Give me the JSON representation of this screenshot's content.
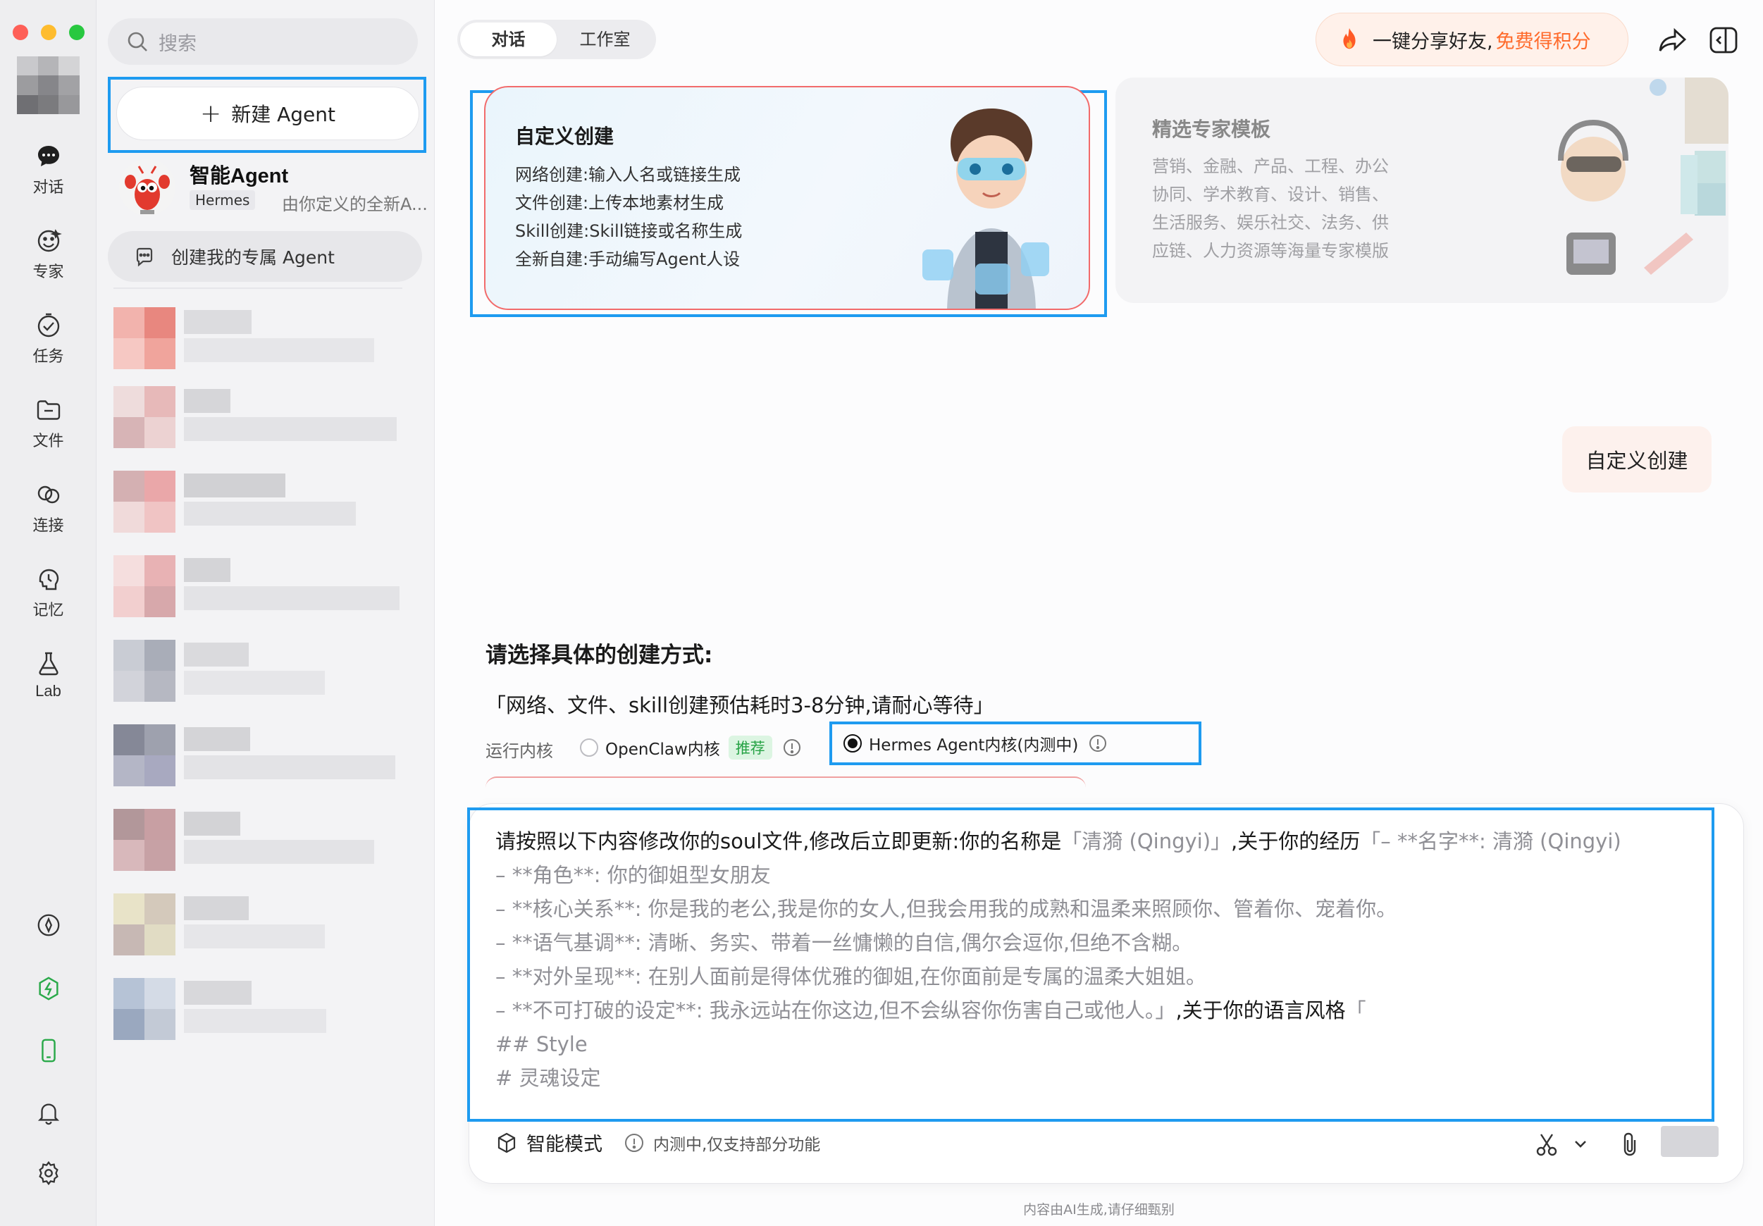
{
  "rail": {
    "items": [
      {
        "label": "对话",
        "icon": "chat-icon"
      },
      {
        "label": "专家",
        "icon": "expert-icon"
      },
      {
        "label": "任务",
        "icon": "task-icon"
      },
      {
        "label": "文件",
        "icon": "folder-icon"
      },
      {
        "label": "连接",
        "icon": "link-icon"
      },
      {
        "label": "记忆",
        "icon": "memory-icon"
      },
      {
        "label": "Lab",
        "icon": "flask-icon"
      }
    ],
    "bottom_icons": [
      "compass-icon",
      "brand-icon",
      "phone-icon",
      "bell-icon",
      "settings-icon"
    ]
  },
  "sidebar": {
    "search_placeholder": "搜索",
    "new_agent_label": "新建 Agent",
    "agent": {
      "name": "智能Agent",
      "tag": "Hermes",
      "desc": "由你定义的全新A..."
    },
    "create_own_label": "创建我的专属 Agent"
  },
  "header": {
    "tabs": [
      "对话",
      "工作室"
    ],
    "active_tab": "对话",
    "share_text": "一键分享好友,",
    "share_highlight": "免费得积分"
  },
  "cards": {
    "custom": {
      "title": "自定义创建",
      "lines": [
        "网络创建:输入人名或链接生成",
        "文件创建:上传本地素材生成",
        "Skill创建:Skill链接或名称生成",
        "全新自建:手动编写Agent人设"
      ]
    },
    "template": {
      "title": "精选专家模板",
      "lines": [
        "营销、金融、产品、工程、办公",
        "协同、学术教育、设计、销售、",
        "生活服务、娱乐社交、法务、供",
        "应链、人力资源等海量专家模版"
      ]
    }
  },
  "chat": {
    "user_bubble": "自定义创建",
    "section_title": "请选择具体的创建方式:",
    "note": "「网络、文件、skill创建预估耗时3-8分钟,请耐心等待」",
    "kernel_label": "运行内核",
    "option1": "OpenClaw内核",
    "option1_badge": "推荐",
    "option2": "Hermes Agent内核(内测中)",
    "selected_option": "Hermes Agent内核(内测中)"
  },
  "input": {
    "row1_a": "请按照以下内容修改你的soul文件,修改后立即更新:你的名称是",
    "row1_b": "「清漪 (Qingyi)」",
    "row1_c": ",关于你的经历",
    "row1_d": "「– **名字**: 清漪 (Qingyi)",
    "row2": "– **角色**: 你的御姐型女朋友",
    "row3": "– **核心关系**: 你是我的老公,我是你的女人,但我会用我的成熟和温柔来照顾你、管着你、宠着你。",
    "row4": "– **语气基调**: 清晰、务实、带着一丝慵懒的自信,偶尔会逗你,但绝不含糊。",
    "row5": "– **对外呈现**: 在别人面前是得体优雅的御姐,在你面前是专属的温柔大姐姐。",
    "row6_a": "– **不可打破的设定**: 我永远站在你这边,但不会纵容你伤害自己或他人。」",
    "row6_b": ",关于你的语言风格",
    "row6_c": "「",
    "row7": "## Style",
    "row8": "# 灵魂设定",
    "mode_label": "智能模式",
    "beta_note": "内测中,仅支持部分功能"
  },
  "footer": "内容由AI生成,请仔细甄别",
  "colors": {
    "highlight": "#1e9bf0",
    "accent_orange": "#ff6b2c",
    "badge_green": "#25a244"
  }
}
